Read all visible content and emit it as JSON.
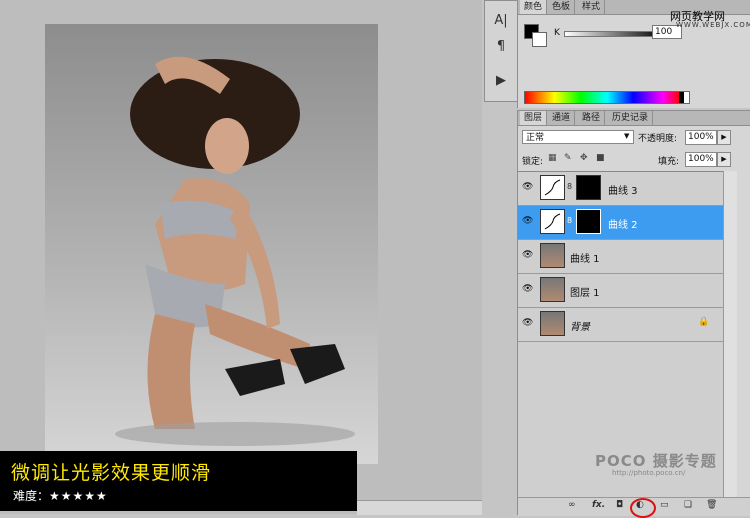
{
  "caption": {
    "title": "微调让光影效果更顺滑",
    "difficulty_label": "难度：",
    "stars": "★★★★★"
  },
  "watermark": {
    "site_name": "网页教学网",
    "site_url": "WWW.WEBJX.COM",
    "poco_logo": "POCO 摄影专题",
    "poco_url": "http://photo.poco.cn/"
  },
  "color_panel": {
    "tabs": [
      "颜色",
      "色板",
      "样式"
    ],
    "channel_label": "K",
    "channel_value": "100"
  },
  "layers_panel": {
    "tabs": [
      "图层",
      "通道",
      "路径",
      "历史记录"
    ],
    "blend_mode": "正常",
    "opacity_label": "不透明度:",
    "opacity_value": "100%",
    "lock_label": "锁定:",
    "fill_label": "填充:",
    "fill_value": "100%",
    "layers": [
      {
        "name": "曲线 3",
        "type": "curves",
        "selected": false
      },
      {
        "name": "曲线 2",
        "type": "curves",
        "selected": true
      },
      {
        "name": "曲线 1",
        "type": "photo",
        "selected": false
      },
      {
        "name": "图层 1",
        "type": "photo",
        "selected": false
      },
      {
        "name": "背景",
        "type": "photo",
        "selected": false,
        "locked": true
      }
    ],
    "bottom_icons": [
      "link-icon",
      "fx-icon",
      "mask-icon",
      "adjustment-layer-icon",
      "group-icon",
      "new-layer-icon",
      "trash-icon"
    ],
    "highlight_color": "#3d9cf0",
    "annotation_color": "#e01010"
  },
  "dock_icons": [
    "character-icon",
    "paragraph-icon",
    "actions-icon"
  ]
}
